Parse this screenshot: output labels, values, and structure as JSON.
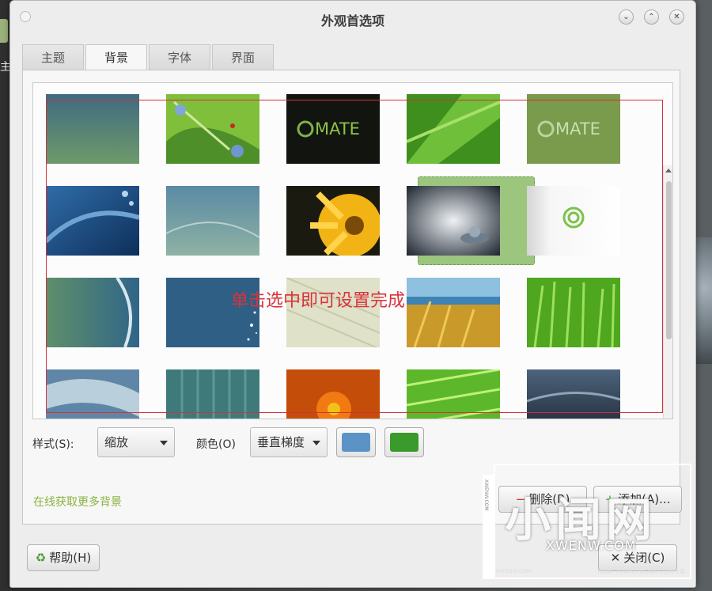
{
  "window": {
    "title": "外观首选项",
    "controls": {
      "minimize": "⌄",
      "maximize": "⌃",
      "close": "✕"
    }
  },
  "desktop": {
    "left_text": "主"
  },
  "tabs": [
    {
      "label": "主题",
      "active": false
    },
    {
      "label": "背景",
      "active": true
    },
    {
      "label": "字体",
      "active": false
    },
    {
      "label": "界面",
      "active": false
    }
  ],
  "wallpapers": [
    {
      "name": "teal-gradient",
      "selected": false
    },
    {
      "name": "flowers-ladybug",
      "selected": false
    },
    {
      "name": "mate-logo-dark",
      "selected": false,
      "text": "MATE"
    },
    {
      "name": "green-leaf-drops",
      "selected": false
    },
    {
      "name": "mate-logo-green",
      "selected": false,
      "text": "MATE"
    },
    {
      "name": "blue-waves-drops",
      "selected": false
    },
    {
      "name": "blue-gray-waves",
      "selected": false
    },
    {
      "name": "yellow-flower",
      "selected": false
    },
    {
      "name": "water-drop-splash",
      "selected": true
    },
    {
      "name": "mate-logo-white",
      "selected": false
    },
    {
      "name": "green-blue-swirl",
      "selected": false
    },
    {
      "name": "blue-sparkle",
      "selected": false
    },
    {
      "name": "cream-leaf-lines",
      "selected": false
    },
    {
      "name": "grass-sea-sky",
      "selected": false
    },
    {
      "name": "green-grass",
      "selected": false
    },
    {
      "name": "pale-blue-waves",
      "selected": false
    },
    {
      "name": "teal-stripes",
      "selected": false
    },
    {
      "name": "orange-flower",
      "selected": false
    },
    {
      "name": "green-leaf-macro",
      "selected": false
    },
    {
      "name": "dark-blue-clouds",
      "selected": false
    }
  ],
  "annotation": {
    "text": "单击选中即可设置完成",
    "color": "#d8333b"
  },
  "options": {
    "style_label": "样式(S):",
    "style_value": "缩放",
    "color_label": "颜色(O)",
    "color_value": "垂直梯度",
    "primary_color": "#5b93c7",
    "secondary_color": "#3b9a2c"
  },
  "links": {
    "more_backgrounds": "在线获取更多背景"
  },
  "buttons": {
    "remove": "删除(R)",
    "add": "添加(A)...",
    "help": "帮助(H)",
    "close": "关闭(C)"
  },
  "watermark": {
    "big": "小闻网",
    "sub": "XWENW.COM",
    "side": "XWENW.COM",
    "foot_left": "XWENW.COM",
    "foot_right": "小闻网（WWW.XWENW.COM)专用"
  },
  "colors": {
    "accent_green": "#8ab341",
    "selection": "#9cc57e",
    "annotation_red": "#d4313b"
  }
}
